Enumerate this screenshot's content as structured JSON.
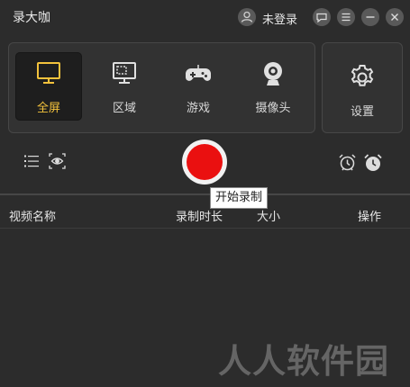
{
  "app": {
    "title": "录大咖"
  },
  "user": {
    "label": "未登录"
  },
  "modes": [
    {
      "label": "全屏"
    },
    {
      "label": "区域"
    },
    {
      "label": "游戏"
    },
    {
      "label": "摄像头"
    }
  ],
  "settings": {
    "label": "设置"
  },
  "record": {
    "tooltip": "开始录制"
  },
  "table": {
    "columns": [
      "视频名称",
      "录制时长",
      "大小",
      "操作"
    ]
  },
  "watermark": "人人软件园",
  "colors": {
    "accent": "#f3c23c",
    "record": "#ea1010",
    "background": "#2c2c2c"
  }
}
